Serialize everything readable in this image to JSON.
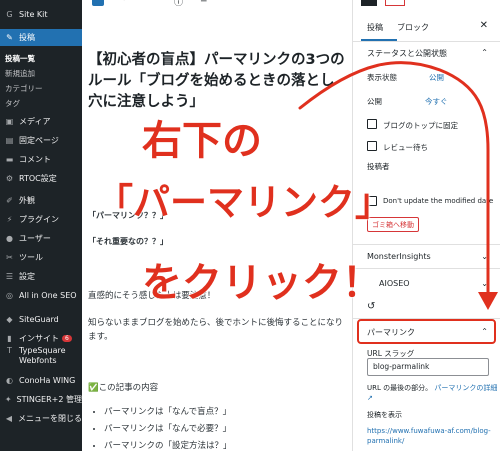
{
  "sidebar": {
    "site_kit": "Site Kit",
    "posts": "投稿",
    "sub_items": [
      "投稿一覧",
      "新規追加",
      "カテゴリー",
      "タグ"
    ],
    "media": "メディア",
    "pages": "固定ページ",
    "comments": "コメント",
    "rtoc": "RTOC設定",
    "appearance": "外観",
    "plugins": "プラグイン",
    "users": "ユーザー",
    "tools": "ツール",
    "settings": "設定",
    "aioseo": "All in One SEO",
    "siteguard": "SiteGuard",
    "insight": "インサイト",
    "insight_badge": "6",
    "typesquare": "TypeSquare Webfonts",
    "conoha": "ConoHa WING",
    "stinger": "STINGER+2 管理",
    "collapse": "メニューを閉じる"
  },
  "editor": {
    "title": "【初心者の盲点】パーマリンクの3つのルール「ブログを始めるときの落とし穴に注意しよう」",
    "q1": "「パーマリンク？？」",
    "q2": "「それ重要なの？？」",
    "p1": "直感的にそう感じた人は要注意！",
    "p2": "知らないままブログを始めたら、後でホントに後悔することになります。",
    "toc_head": "✅この記事の内容",
    "bullets": [
      "パーマリンクは「なんで盲点？」",
      "パーマリンクは「なんで必要？」",
      "パーマリンクの「設定方法は？」"
    ]
  },
  "panel": {
    "tab_post": "投稿",
    "tab_block": "ブロック",
    "status_title": "ステータスと公開状態",
    "visibility_label": "表示状態",
    "visibility_value": "公開",
    "publish_label": "公開",
    "publish_value": "今すぐ",
    "sticky_label": "ブログのトップに固定",
    "review_label": "レビュー待ち",
    "author_label": "投稿者",
    "dont_update": "Don't update the modified date",
    "trash": "ゴミ箱へ移動",
    "monsterinsights": "MonsterInsights",
    "aioseo": "AIOSEO",
    "permalink": "パーマリンク",
    "url_slug_label": "URL スラッグ",
    "url_slug_value": "blog-parmalink",
    "url_desc": "URL の最後の部分。",
    "url_desc_link": "パーマリンクの詳細",
    "view_post": "投稿を表示",
    "post_url": "https://www.fuwafuwa-af.com/blog-parmalink/"
  },
  "annotation": {
    "line1": "右下の",
    "line2": "「パーマリンク」",
    "line3": "をクリック！",
    "color": "#e0301e"
  }
}
